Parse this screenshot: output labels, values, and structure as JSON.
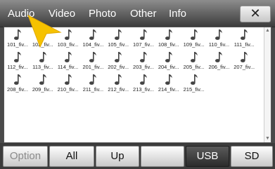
{
  "tabs": [
    {
      "label": "Audio"
    },
    {
      "label": "Video"
    },
    {
      "label": "Photo"
    },
    {
      "label": "Other"
    },
    {
      "label": "Info"
    }
  ],
  "close_label": "✕",
  "files": [
    "101_fiv...",
    "102_fiv...",
    "103_fiv...",
    "104_fiv...",
    "105_fiv...",
    "107_fiv...",
    "108_fiv...",
    "109_fiv...",
    "110_fiv...",
    "111_fiv...",
    "112_fiv...",
    "113_fiv...",
    "114_fiv...",
    "201_fiv...",
    "202_fiv...",
    "203_fiv...",
    "204_fiv...",
    "205_fiv...",
    "206_fiv...",
    "207_fiv...",
    "208_fiv...",
    "209_fiv...",
    "210_fiv...",
    "211_fiv...",
    "212_fiv...",
    "213_fiv...",
    "214_fiv...",
    "215_fiv..."
  ],
  "file_icon": "music-note-icon",
  "bottom_buttons": [
    {
      "label": "Option",
      "state": "disabled"
    },
    {
      "label": "All",
      "state": "normal"
    },
    {
      "label": "Up",
      "state": "normal"
    },
    {
      "label": "",
      "state": "normal"
    },
    {
      "label": "USB",
      "state": "active"
    },
    {
      "label": "SD",
      "state": "normal"
    }
  ]
}
